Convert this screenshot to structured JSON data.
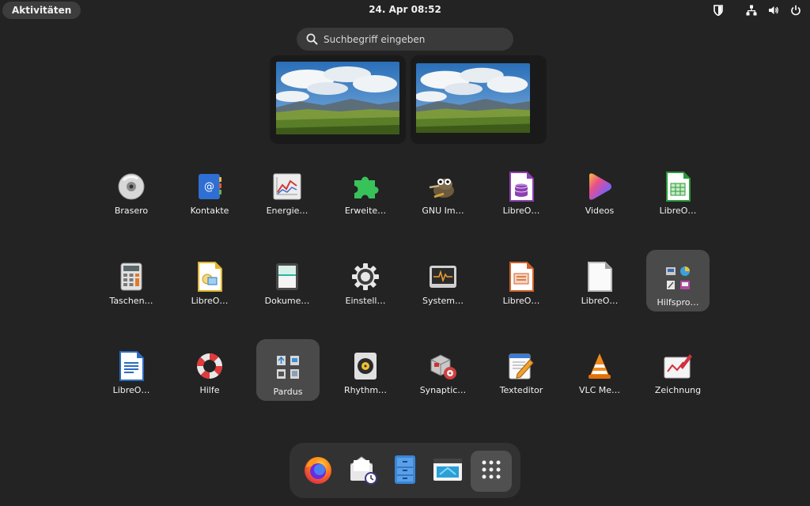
{
  "topbar": {
    "activities_label": "Aktivitäten",
    "clock": "24. Apr  08:52",
    "tray_icons": [
      "shield-icon",
      "network-icon",
      "volume-icon",
      "power-icon"
    ]
  },
  "search": {
    "placeholder": "Suchbegriff eingeben",
    "value": ""
  },
  "workspaces": [
    {
      "name": "workspace-1"
    },
    {
      "name": "workspace-2"
    }
  ],
  "apps": [
    {
      "label": "Brasero",
      "icon": "disc-icon"
    },
    {
      "label": "Kontakte",
      "icon": "contacts-icon"
    },
    {
      "label": "Energie…",
      "icon": "power-statistics-icon"
    },
    {
      "label": "Erweite…",
      "icon": "puzzle-icon"
    },
    {
      "label": "GNU Im…",
      "icon": "gimp-icon"
    },
    {
      "label": "LibreO…",
      "icon": "libreoffice-base-icon"
    },
    {
      "label": "Videos",
      "icon": "videos-icon"
    },
    {
      "label": "LibreO…",
      "icon": "libreoffice-calc-icon"
    },
    {
      "label": "Taschen…",
      "icon": "calculator-icon"
    },
    {
      "label": "LibreO…",
      "icon": "libreoffice-draw-icon"
    },
    {
      "label": "Dokume…",
      "icon": "document-scanner-icon"
    },
    {
      "label": "Einstell…",
      "icon": "settings-gear-icon"
    },
    {
      "label": "System…",
      "icon": "system-monitor-icon"
    },
    {
      "label": "LibreO…",
      "icon": "libreoffice-impress-icon"
    },
    {
      "label": "LibreO…",
      "icon": "libreoffice-icon"
    },
    {
      "label": "Hilfspro…",
      "icon": "utilities-folder-icon"
    },
    {
      "label": "LibreO…",
      "icon": "libreoffice-writer-icon"
    },
    {
      "label": "Hilfe",
      "icon": "help-lifebuoy-icon"
    },
    {
      "label": "Pardus",
      "icon": "pardus-folder-icon"
    },
    {
      "label": "Rhythm…",
      "icon": "rhythmbox-icon"
    },
    {
      "label": "Synaptic…",
      "icon": "synaptic-icon"
    },
    {
      "label": "Texteditor",
      "icon": "text-editor-icon"
    },
    {
      "label": "VLC Me…",
      "icon": "vlc-icon"
    },
    {
      "label": "Zeichnung",
      "icon": "drawing-icon"
    }
  ],
  "dock": [
    "firefox-icon",
    "mail-icon",
    "file-manager-icon",
    "software-store-icon",
    "show-apps-icon"
  ],
  "colors": {
    "background": "#232323",
    "highlight": "#4a4a4a",
    "dock": "#323232"
  }
}
